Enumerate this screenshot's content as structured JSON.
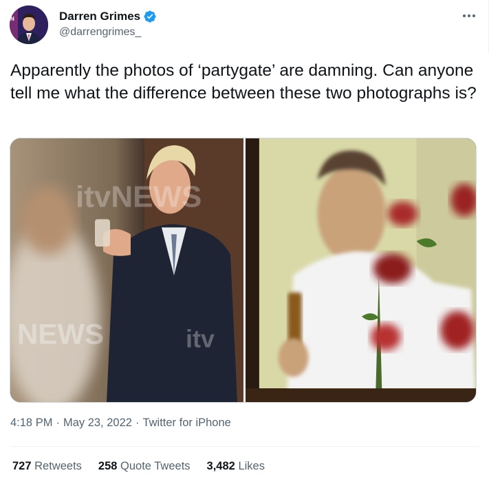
{
  "author": {
    "display_name": "Darren Grimes",
    "handle": "@darrengrimes_",
    "verified": true,
    "avatar_icon": "user-avatar"
  },
  "tweet": {
    "text": "Apparently the photos of ‘partygate’ are damning. Can anyone tell me what the difference between these two photographs is?"
  },
  "media": {
    "left_photo": {
      "watermark_top": "itvNEWS",
      "watermark_bottom_left": "NEWS",
      "watermark_bottom_right": "itv"
    },
    "right_photo": {}
  },
  "meta": {
    "time": "4:18 PM",
    "separator": "·",
    "date": "May 23, 2022",
    "source": "Twitter for iPhone"
  },
  "stats": {
    "retweets": {
      "count": "727",
      "label": "Retweets"
    },
    "quotes": {
      "count": "258",
      "label": "Quote Tweets"
    },
    "likes": {
      "count": "3,482",
      "label": "Likes"
    }
  },
  "colors": {
    "verified": "#1d9bf0",
    "text": "#0f1419",
    "secondary": "#536471",
    "rule": "#eff3f4"
  }
}
